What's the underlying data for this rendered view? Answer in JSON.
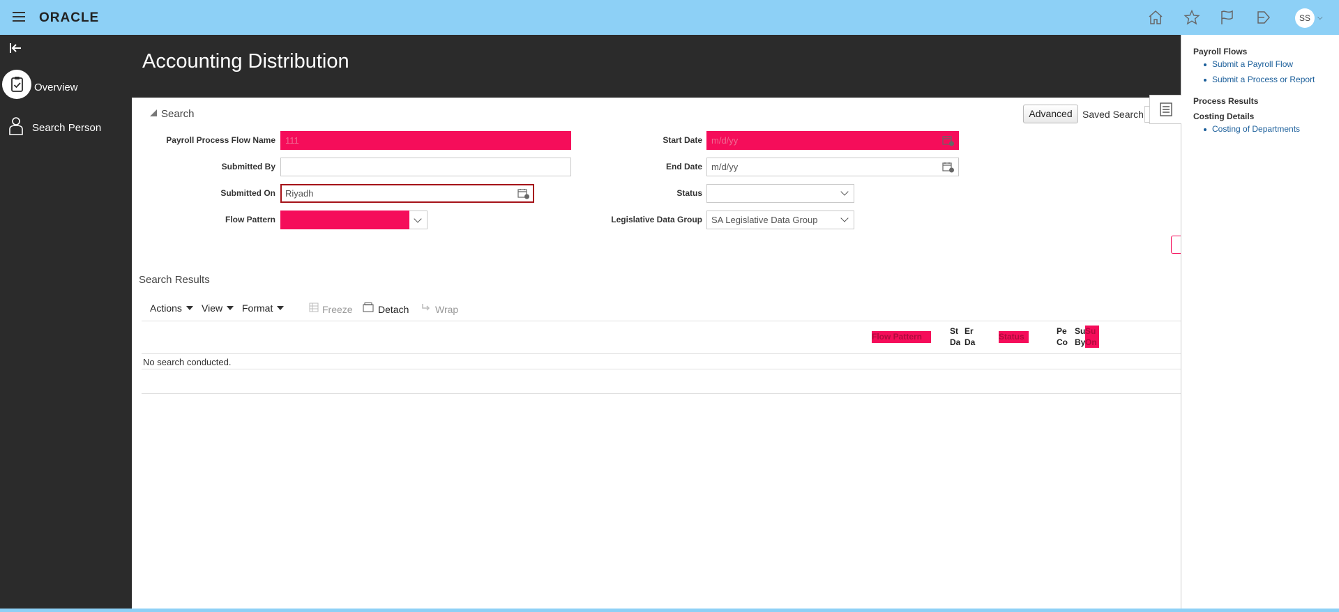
{
  "topbar": {
    "logo": "ORACLE",
    "icons": [
      "menu-icon",
      "home-icon",
      "star-icon",
      "flag-icon",
      "send-icon"
    ],
    "avatar_initials": "SS"
  },
  "sidebar": {
    "items": [
      {
        "label": "Overview",
        "icon": "clipboard-check-icon"
      },
      {
        "label": "Search Person",
        "icon": "person-search-icon"
      }
    ]
  },
  "page": {
    "title": "Accounting Distribution"
  },
  "search": {
    "toggle_label": "Search",
    "advanced_label": "Advanced",
    "saved_search_label": "Saved Search",
    "fields": {
      "payroll_process_flow_name": {
        "label": "Payroll Process Flow Name",
        "value": "111"
      },
      "submitted_by": {
        "label": "Submitted By",
        "value": ""
      },
      "submitted_on": {
        "label": "Submitted On",
        "value": "Riyadh"
      },
      "flow_pattern": {
        "label": "Flow Pattern",
        "value": ""
      },
      "start_date": {
        "label": "Start Date",
        "placeholder": "m/d/yy"
      },
      "end_date": {
        "label": "End Date",
        "placeholder": "m/d/yy"
      },
      "status": {
        "label": "Status",
        "value": ""
      },
      "legislative_data_group": {
        "label": "Legislative Data Group",
        "value": "SA Legislative Data Group"
      }
    }
  },
  "results": {
    "title": "Search Results",
    "toolbar": {
      "actions": "Actions",
      "view": "View",
      "format": "Format",
      "freeze": "Freeze",
      "detach": "Detach",
      "wrap": "Wrap"
    },
    "columns": [
      {
        "line1": "Flow Pattern",
        "line2": ""
      },
      {
        "line1": "St",
        "line2": "Da"
      },
      {
        "line1": "Er",
        "line2": "Da"
      },
      {
        "line1": "Status",
        "line2": ""
      },
      {
        "line1": "Pe",
        "line2": "Co"
      },
      {
        "line1": "Su",
        "line2": "By"
      },
      {
        "line1": "Su",
        "line2": "On"
      }
    ],
    "empty_message": "No search conducted."
  },
  "right_panel": {
    "payroll_flows_heading": "Payroll Flows",
    "links_flows": [
      "Submit a Payroll Flow",
      "Submit a Process or Report"
    ],
    "process_results_heading": "Process Results",
    "costing_details_heading": "Costing Details",
    "links_costing": [
      "Costing of Departments"
    ]
  },
  "colors": {
    "topbar": "#8dd0f6",
    "dark": "#2b2b2b",
    "highlight": "#f50d5a",
    "link": "#1a5e9a"
  }
}
